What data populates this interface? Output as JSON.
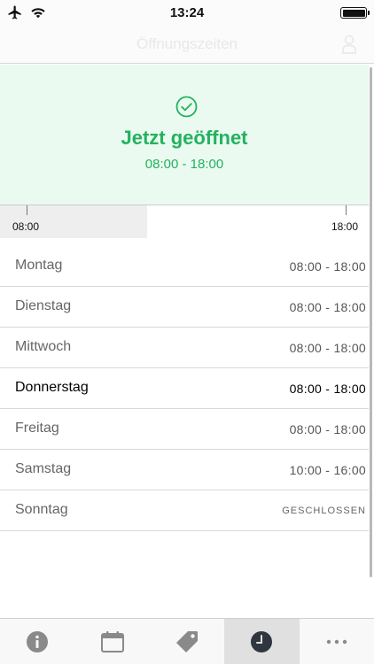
{
  "status_bar": {
    "time": "13:24"
  },
  "nav": {
    "title": "Öffnungszeiten"
  },
  "banner": {
    "title": "Jetzt geöffnet",
    "hours": "08:00 - 18:00",
    "accent_color": "#23b25f"
  },
  "timeline": {
    "start_label": "08:00",
    "end_label": "18:00",
    "elapsed_fraction": 0.4
  },
  "days": [
    {
      "name": "Montag",
      "hours": "08:00 - 18:00"
    },
    {
      "name": "Dienstag",
      "hours": "08:00 - 18:00"
    },
    {
      "name": "Mittwoch",
      "hours": "08:00 - 18:00"
    },
    {
      "name": "Donnerstag",
      "hours": "08:00 - 18:00"
    },
    {
      "name": "Freitag",
      "hours": "08:00 - 18:00"
    },
    {
      "name": "Samstag",
      "hours": "10:00 - 16:00"
    },
    {
      "name": "Sonntag",
      "hours": "GESCHLOSSEN"
    }
  ],
  "tabs": [
    {
      "icon": "info-icon"
    },
    {
      "icon": "calendar-icon"
    },
    {
      "icon": "tag-icon"
    },
    {
      "icon": "clock-icon",
      "active": true
    },
    {
      "icon": "more-icon"
    }
  ]
}
